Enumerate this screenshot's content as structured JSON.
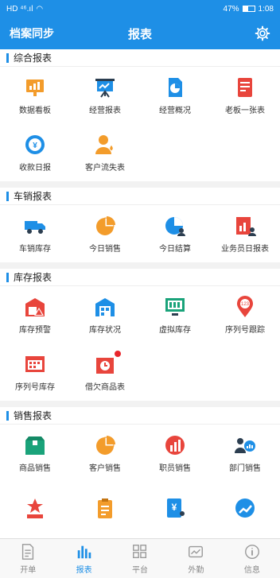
{
  "status_bar": {
    "left": "HD ⁴⁶.ıl",
    "battery": "47%",
    "time": "1:08"
  },
  "header": {
    "left_label": "档案同步",
    "title": "报表"
  },
  "sections": [
    {
      "title": "综合报表",
      "items": [
        {
          "label": "数据看板",
          "icon": "board-icon"
        },
        {
          "label": "经营报表",
          "icon": "presentation-icon"
        },
        {
          "label": "经营概况",
          "icon": "pie-doc-icon"
        },
        {
          "label": "老板一张表",
          "icon": "sheet-icon"
        },
        {
          "label": "收款日报",
          "icon": "clock-yen-icon"
        },
        {
          "label": "客户流失表",
          "icon": "user-drop-icon"
        }
      ]
    },
    {
      "title": "车销报表",
      "items": [
        {
          "label": "车销库存",
          "icon": "truck-icon"
        },
        {
          "label": "今日销售",
          "icon": "pie-icon"
        },
        {
          "label": "今日结算",
          "icon": "pie-user-icon"
        },
        {
          "label": "业务员日报表",
          "icon": "report-user-icon"
        }
      ]
    },
    {
      "title": "库存报表",
      "items": [
        {
          "label": "库存预警",
          "icon": "warehouse-alert-icon"
        },
        {
          "label": "库存状况",
          "icon": "warehouse-icon"
        },
        {
          "label": "虚拟库存",
          "icon": "monitor-icon"
        },
        {
          "label": "序列号跟踪",
          "icon": "location-123-icon"
        },
        {
          "label": "序列号库存",
          "icon": "serial-grid-icon"
        },
        {
          "label": "借欠商品表",
          "icon": "box-clock-icon"
        }
      ]
    },
    {
      "title": "销售报表",
      "items": [
        {
          "label": "商品销售",
          "icon": "box-icon"
        },
        {
          "label": "客户销售",
          "icon": "pie-icon"
        },
        {
          "label": "职员销售",
          "icon": "growth-chart-icon"
        },
        {
          "label": "部门销售",
          "icon": "dept-icon"
        },
        {
          "label": "",
          "icon": "star-podium-icon"
        },
        {
          "label": "",
          "icon": "clipboard-icon"
        },
        {
          "label": "",
          "icon": "yen-doc-icon"
        },
        {
          "label": "",
          "icon": "trend-icon"
        }
      ]
    }
  ],
  "tabs": [
    {
      "label": "开单",
      "icon": "document-icon",
      "active": false
    },
    {
      "label": "报表",
      "icon": "bar-chart-icon",
      "active": true
    },
    {
      "label": "平台",
      "icon": "grid-icon",
      "active": false
    },
    {
      "label": "外勤",
      "icon": "map-icon",
      "active": false
    },
    {
      "label": "信息",
      "icon": "info-icon",
      "active": false
    }
  ],
  "colors": {
    "primary": "#1e8fe6",
    "orange": "#f39c2b",
    "red": "#e8453c",
    "green": "#1aa37a"
  }
}
